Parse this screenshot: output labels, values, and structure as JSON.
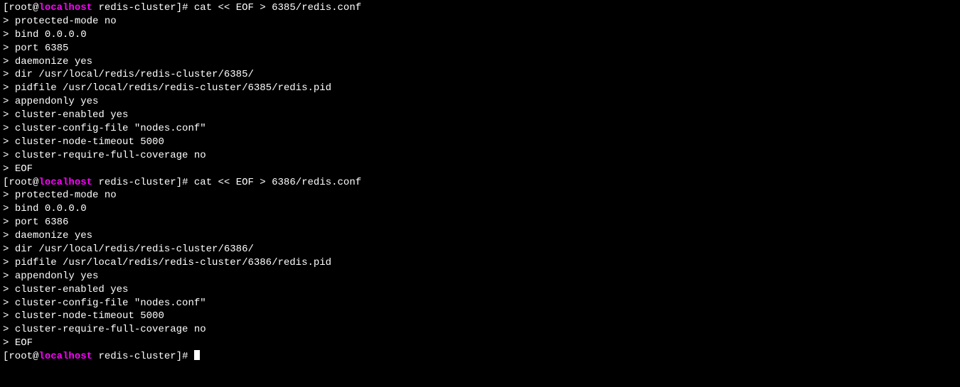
{
  "prompt": {
    "open_bracket": "[",
    "user": "root",
    "at": "@",
    "host": "localhost",
    "space": " ",
    "path": "redis-cluster",
    "close_bracket": "]",
    "hash": "# "
  },
  "continuation": "> ",
  "blocks": [
    {
      "command": "cat << EOF > 6385/redis.conf",
      "lines": [
        "protected-mode no",
        "bind 0.0.0.0",
        "port 6385",
        "daemonize yes",
        "dir /usr/local/redis/redis-cluster/6385/",
        "pidfile /usr/local/redis/redis-cluster/6385/redis.pid",
        "appendonly yes",
        "cluster-enabled yes",
        "cluster-config-file \"nodes.conf\"",
        "cluster-node-timeout 5000",
        "cluster-require-full-coverage no",
        "EOF"
      ]
    },
    {
      "command": "cat << EOF > 6386/redis.conf",
      "lines": [
        "protected-mode no",
        "bind 0.0.0.0",
        "port 6386",
        "daemonize yes",
        "dir /usr/local/redis/redis-cluster/6386/",
        "pidfile /usr/local/redis/redis-cluster/6386/redis.pid",
        "appendonly yes",
        "cluster-enabled yes",
        "cluster-config-file \"nodes.conf\"",
        "cluster-node-timeout 5000",
        "cluster-require-full-coverage no",
        "EOF"
      ]
    }
  ]
}
